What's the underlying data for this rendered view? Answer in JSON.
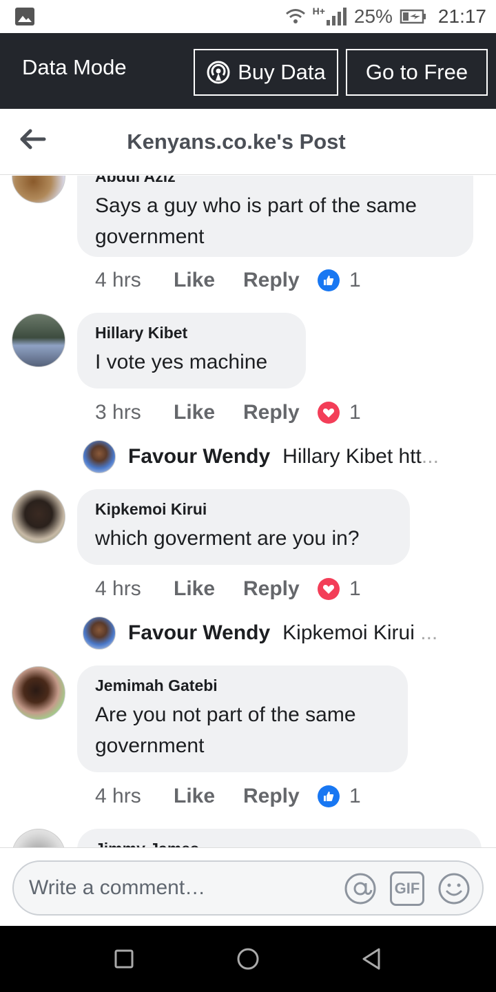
{
  "status_bar": {
    "network": "H+",
    "battery": "25%",
    "time": "21:17"
  },
  "data_mode": {
    "label": "Data Mode",
    "buy_label": "Buy Data",
    "free_label": "Go to Free"
  },
  "header": {
    "title": "Kenyans.co.ke's Post"
  },
  "comments": [
    {
      "author": "Abdul Aziz",
      "lines": [
        "Says a guy who is part of the same",
        "government"
      ],
      "time": "4 hrs",
      "like": "Like",
      "reply": "Reply",
      "reaction": "like",
      "count": "1"
    },
    {
      "author": "Hillary Kibet",
      "lines": [
        "I vote yes machine"
      ],
      "time": "3 hrs",
      "like": "Like",
      "reply": "Reply",
      "reaction": "love",
      "count": "1",
      "reply_preview": {
        "name": "Favour Wendy",
        "text": "Hillary Kibet htt",
        "ellipsis": "..."
      }
    },
    {
      "author": "Kipkemoi Kirui",
      "lines": [
        "which goverment are you in?"
      ],
      "time": "4 hrs",
      "like": "Like",
      "reply": "Reply",
      "reaction": "love",
      "count": "1",
      "reply_preview": {
        "name": "Favour Wendy",
        "text": "Kipkemoi Kirui",
        "ellipsis": "..."
      }
    },
    {
      "author": "Jemimah Gatebi",
      "lines": [
        "Are you not part of the same",
        "government"
      ],
      "time": "4 hrs",
      "like": "Like",
      "reply": "Reply",
      "reaction": "like",
      "count": "1"
    },
    {
      "author": "Jimmy James",
      "lines": [],
      "partial": true
    }
  ],
  "composer": {
    "placeholder": "Write a comment…",
    "gif_label": "GIF"
  },
  "colors": {
    "datamode_bg": "#23262c",
    "bubble_bg": "#f0f1f3",
    "like_blue": "#1877f2",
    "love_red": "#f33e58"
  }
}
